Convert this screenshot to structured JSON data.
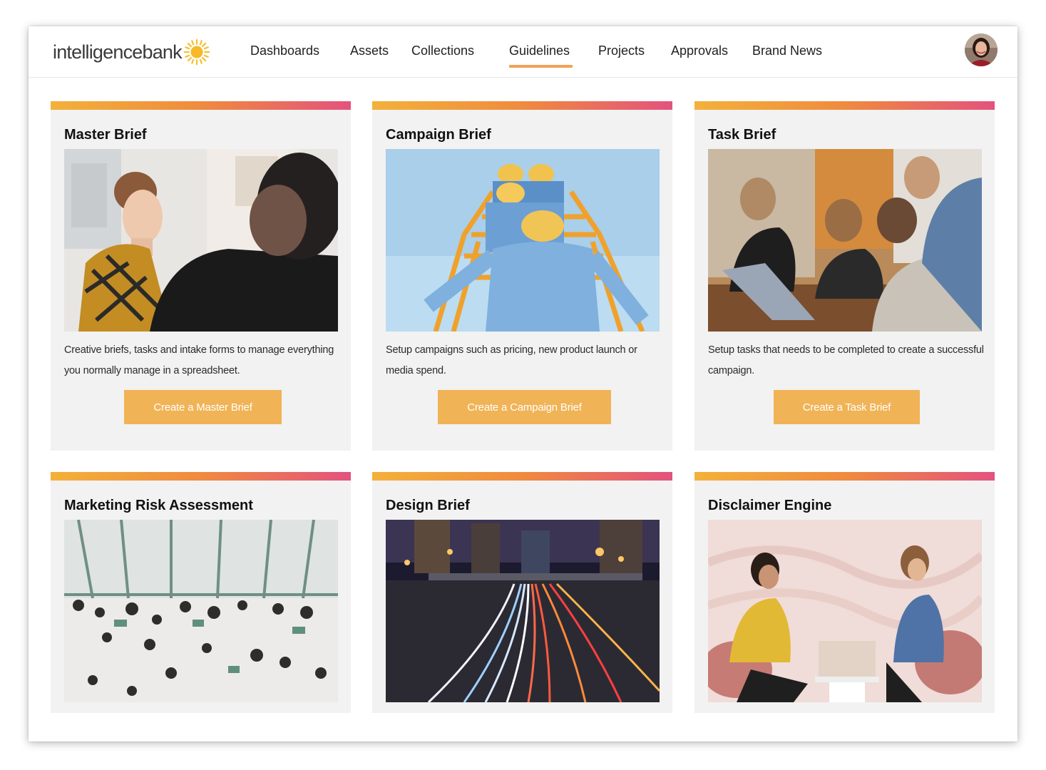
{
  "header": {
    "logo_text": "intelligencebank",
    "nav": [
      {
        "label": "Dashboards"
      },
      {
        "label": "Assets"
      },
      {
        "label": "Collections"
      },
      {
        "label": "Guidelines",
        "active": true
      },
      {
        "label": "Projects"
      },
      {
        "label": "Approvals"
      },
      {
        "label": "Brand News"
      }
    ],
    "accent_color": "#f0a255"
  },
  "cards": [
    {
      "title": "Master Brief",
      "image": "photo-colleagues-conversation",
      "description": "Creative briefs, tasks and intake forms to manage everything you normally manage in a spreadsheet.",
      "button": "Create a Master Brief"
    },
    {
      "title": "Campaign Brief",
      "image": "photo-workers-climbing-ladder",
      "description": "Setup campaigns such as pricing, new product launch or media spend.",
      "button": "Create a Campaign Brief"
    },
    {
      "title": "Task Brief",
      "image": "photo-team-around-laptop",
      "description": "Setup tasks that needs to be completed to create a successful campaign.",
      "button": "Create a Task Brief"
    },
    {
      "title": "Marketing Risk Assessment",
      "image": "photo-aerial-lobby-crowd"
    },
    {
      "title": "Design Brief",
      "image": "photo-city-light-trails"
    },
    {
      "title": "Disclaimer Engine",
      "image": "photo-two-women-chatting"
    }
  ],
  "colors": {
    "card_bar_gradient": [
      "#f3b13a",
      "#ef8b3f",
      "#e4527d"
    ],
    "button": "#f0b356",
    "card_background": "#f2f2f2"
  }
}
